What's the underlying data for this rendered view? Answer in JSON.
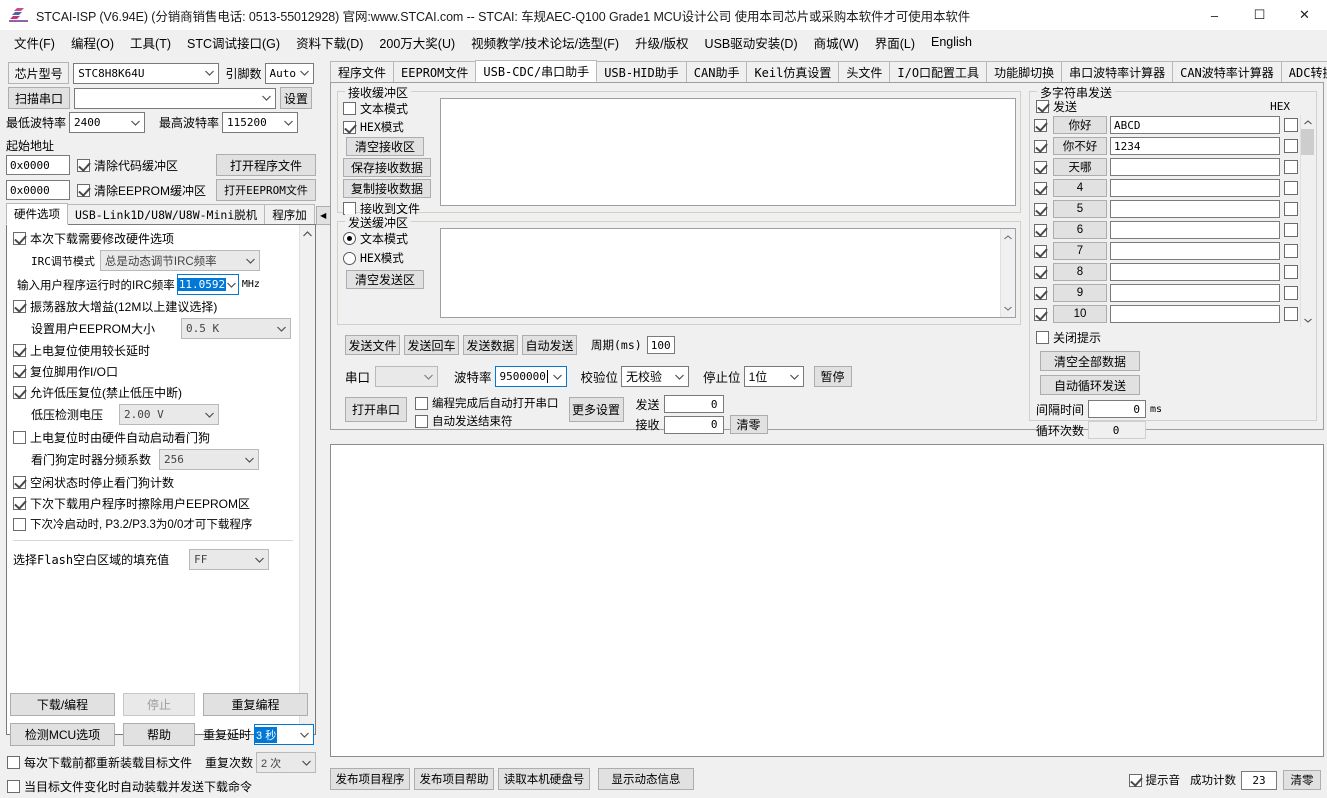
{
  "window": {
    "title": "STCAI-ISP (V6.94E) (分销商销售电话: 0513-55012928) 官网:www.STCAI.com  -- STCAI: 车规AEC-Q100 Grade1 MCU设计公司 使用本司芯片或采购本软件才可使用本软件",
    "minimize": "–",
    "maximize": "☐",
    "close": "✕"
  },
  "menu": [
    "文件(F)",
    "编程(O)",
    "工具(T)",
    "STC调试接口(G)",
    "资料下载(D)",
    "200万大奖(U)",
    "视频教学/技术论坛/选型(F)",
    "升级/版权",
    "USB驱动安装(D)",
    "商城(W)",
    "界面(L)",
    "English"
  ],
  "left": {
    "chip_label": "芯片型号",
    "chip_value": "STC8H8K64U",
    "pins_label": "引脚数",
    "pins_value": "Auto",
    "scan_port_button": "扫描串口",
    "port_value": "",
    "settings_button": "设置",
    "min_baud_label": "最低波特率",
    "min_baud_value": "2400",
    "max_baud_label": "最高波特率",
    "max_baud_value": "115200",
    "start_address_label": "起始地址",
    "addr_code_value": "0x0000",
    "clear_code_buffer": "清除代码缓冲区",
    "open_program_file": "打开程序文件",
    "addr_eeprom_value": "0x0000",
    "clear_eeprom_buffer": "清除EEPROM缓冲区",
    "open_eeprom_file": "打开EEPROM文件",
    "tabs": [
      {
        "label": "硬件选项",
        "active": true
      },
      {
        "label": "USB-Link1D/U8W/U8W-Mini脱机",
        "active": false
      },
      {
        "label": "程序加",
        "active": false
      }
    ],
    "tab_prev": "◀",
    "tab_next": "▶",
    "options": {
      "modify_hw_options": "本次下载需要修改硬件选项",
      "irc_mode_label": "IRC调节模式",
      "irc_mode_value": "总是动态调节IRC频率",
      "irc_freq_label": "输入用户程序运行时的IRC频率",
      "irc_freq_value": "11.0592",
      "irc_freq_unit": "MHz",
      "osc_gain": "振荡器放大增益(12M以上建议选择)",
      "eeprom_size_label": "设置用户EEPROM大小",
      "eeprom_size_value": "0.5 K",
      "power_on_delay": "上电复位使用较长延时",
      "reset_pin_io": "复位脚用作I/O口",
      "low_voltage_reset": "允许低压复位(禁止低压中断)",
      "low_voltage_label": "低压检测电压",
      "low_voltage_value": "2.00 V",
      "auto_watchdog": "上电复位时由硬件自动启动看门狗",
      "watchdog_div_label": "看门狗定时器分频系数",
      "watchdog_div_value": "256",
      "idle_stop_watchdog": "空闲状态时停止看门狗计数",
      "erase_eeprom_next": "下次下载用户程序时擦除用户EEPROM区",
      "cold_start_p32": "下次冷启动时, P3.2/P3.3为0/0才可下载程序",
      "flash_fill_label": "选择Flash空白区域的填充值",
      "flash_fill_value": "FF"
    },
    "actions": {
      "download": "下载/编程",
      "stop": "停止",
      "repeat": "重复编程",
      "detect_mcu": "检测MCU选项",
      "help": "帮助",
      "repeat_delay_label": "重复延时",
      "repeat_delay_value": "3 秒",
      "repeat_count_label": "重复次数",
      "repeat_count_value": "2 次",
      "reload_each_time": "每次下载前都重新装载目标文件",
      "auto_reload_on_change": "当目标文件变化时自动装载并发送下载命令"
    }
  },
  "main_tabs": [
    {
      "label": "程序文件",
      "active": false,
      "cn": true
    },
    {
      "label": "EEPROM文件",
      "active": false,
      "cn": false
    },
    {
      "label": "USB-CDC/串口助手",
      "active": true,
      "cn": false
    },
    {
      "label": "USB-HID助手",
      "active": false,
      "cn": false
    },
    {
      "label": "CAN助手",
      "active": false,
      "cn": false
    },
    {
      "label": "Keil仿真设置",
      "active": false,
      "cn": false
    },
    {
      "label": "头文件",
      "active": false,
      "cn": true
    },
    {
      "label": "I/O口配置工具",
      "active": false,
      "cn": false
    },
    {
      "label": "功能脚切换",
      "active": false,
      "cn": true
    },
    {
      "label": "串口波特率计算器",
      "active": false,
      "cn": true
    },
    {
      "label": "CAN波特率计算器",
      "active": false,
      "cn": false
    },
    {
      "label": "ADC转换速度计算",
      "active": false,
      "cn": false
    }
  ],
  "main_tab_prev": "◀",
  "main_tab_next": "▶",
  "serial": {
    "receive": {
      "group_title": "接收缓冲区",
      "text_mode": "文本模式",
      "text_mode_checked": false,
      "hex_mode": "HEX模式",
      "hex_mode_checked": true,
      "clear_button": "清空接收区",
      "save_button": "保存接收数据",
      "copy_button": "复制接收数据",
      "to_file": "接收到文件",
      "to_file_checked": false,
      "content": ""
    },
    "send": {
      "group_title": "发送缓冲区",
      "text_mode": "文本模式",
      "hex_mode": "HEX模式",
      "mode_selected": "text",
      "clear_button": "清空发送区",
      "content": "",
      "send_file": "发送文件",
      "send_return": "发送回车",
      "send_data": "发送数据",
      "auto_send": "自动发送",
      "period_label": "周期(ms)",
      "period_value": "100"
    },
    "config": {
      "port_label": "串口",
      "port_value": "",
      "baud_label": "波特率",
      "baud_value": "9500000",
      "parity_label": "校验位",
      "parity_value": "无校验",
      "stopbits_label": "停止位",
      "stopbits_value": "1位",
      "pause_button": "暂停",
      "open_port_button": "打开串口",
      "auto_open_after_program": "编程完成后自动打开串口",
      "auto_send_terminator": "自动发送结束符",
      "more_settings_button": "更多设置",
      "tx_label": "发送",
      "tx_value": "0",
      "rx_label": "接收",
      "rx_value": "0",
      "reset_counters_button": "清零"
    }
  },
  "multisend": {
    "group_title": "多字符串发送",
    "send_all_label": "发送",
    "send_all_checked": true,
    "hex_header": "HEX",
    "rows": [
      {
        "enabled": true,
        "label": "你好",
        "value": "ABCD",
        "hex": false
      },
      {
        "enabled": true,
        "label": "你不好",
        "value": "1234",
        "hex": false
      },
      {
        "enabled": true,
        "label": "天哪",
        "value": "",
        "hex": false
      },
      {
        "enabled": true,
        "label": "4",
        "value": "",
        "hex": false
      },
      {
        "enabled": true,
        "label": "5",
        "value": "",
        "hex": false
      },
      {
        "enabled": true,
        "label": "6",
        "value": "",
        "hex": false
      },
      {
        "enabled": true,
        "label": "7",
        "value": "",
        "hex": false
      },
      {
        "enabled": true,
        "label": "8",
        "value": "",
        "hex": false
      },
      {
        "enabled": true,
        "label": "9",
        "value": "",
        "hex": false
      },
      {
        "enabled": true,
        "label": "10",
        "value": "",
        "hex": false
      }
    ],
    "close_tip": "关闭提示",
    "close_tip_checked": false,
    "clear_all_button": "清空全部数据",
    "auto_loop_button": "自动循环发送",
    "interval_label": "间隔时间",
    "interval_value": "0",
    "interval_unit": "ms",
    "loop_count_label": "循环次数",
    "loop_count_value": "0"
  },
  "bottom": {
    "publish_program": "发布项目程序",
    "publish_help": "发布项目帮助",
    "read_disk_id": "读取本机硬盘号",
    "show_dynamic_info": "显示动态信息",
    "beep_label": "提示音",
    "beep_checked": true,
    "success_count_label": "成功计数",
    "success_count_value": "23",
    "reset_button": "清零"
  },
  "colors": {
    "accent": "#0078d7",
    "window_bg": "#f0f0f0",
    "panel_bg": "#ffffff",
    "selection": "#0078d7"
  }
}
